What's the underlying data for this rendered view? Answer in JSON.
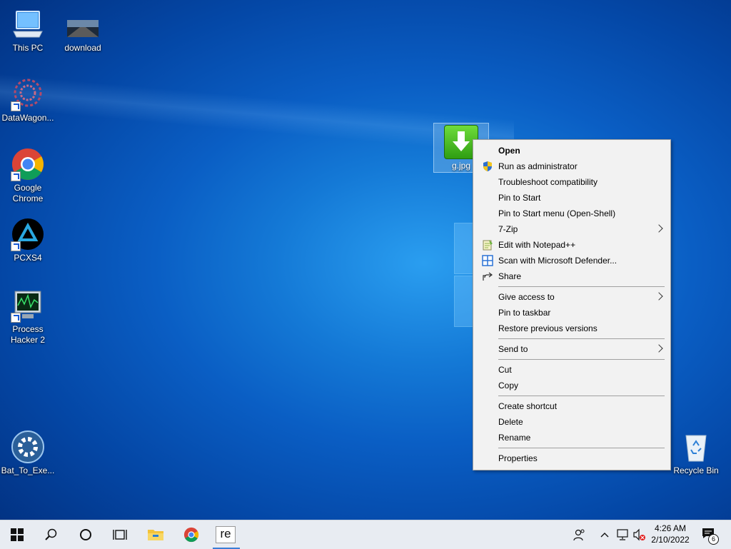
{
  "desktop": {
    "icons": [
      {
        "label": "This PC"
      },
      {
        "label": "download"
      },
      {
        "label": "DataWagon..."
      },
      {
        "label": "Google Chrome"
      },
      {
        "label": "PCXS4"
      },
      {
        "label": "Process Hacker 2"
      },
      {
        "label": "Bat_To_Exe..."
      },
      {
        "label": "Recycle Bin"
      },
      {
        "label": "g.jpg"
      }
    ]
  },
  "context_menu": {
    "items": [
      {
        "label": "Open"
      },
      {
        "label": "Run as administrator",
        "icon": "shield-icon"
      },
      {
        "label": "Troubleshoot compatibility"
      },
      {
        "label": "Pin to Start"
      },
      {
        "label": "Pin to Start menu (Open-Shell)"
      },
      {
        "label": "7-Zip",
        "submenu": true
      },
      {
        "label": "Edit with Notepad++",
        "icon": "notepadpp-icon"
      },
      {
        "label": "Scan with Microsoft Defender...",
        "icon": "defender-icon"
      },
      {
        "label": "Share",
        "icon": "share-icon"
      },
      {
        "label": "Give access to",
        "submenu": true
      },
      {
        "label": "Pin to taskbar"
      },
      {
        "label": "Restore previous versions"
      },
      {
        "label": "Send to",
        "submenu": true
      },
      {
        "label": "Cut"
      },
      {
        "label": "Copy"
      },
      {
        "label": "Create shortcut"
      },
      {
        "label": "Delete"
      },
      {
        "label": "Rename"
      },
      {
        "label": "Properties"
      }
    ]
  },
  "taskbar": {
    "pinned": [
      "start-icon",
      "search-icon",
      "cortana-icon",
      "task-view-icon",
      "file-explorer-icon",
      "chrome-icon",
      "re-app-icon"
    ],
    "re_label": "re",
    "clock_time": "4:26 AM",
    "clock_date": "2/10/2022",
    "notification_count": "6"
  },
  "colors": {
    "accent": "#3b7ed6",
    "menu_bg": "#f2f2f2"
  }
}
